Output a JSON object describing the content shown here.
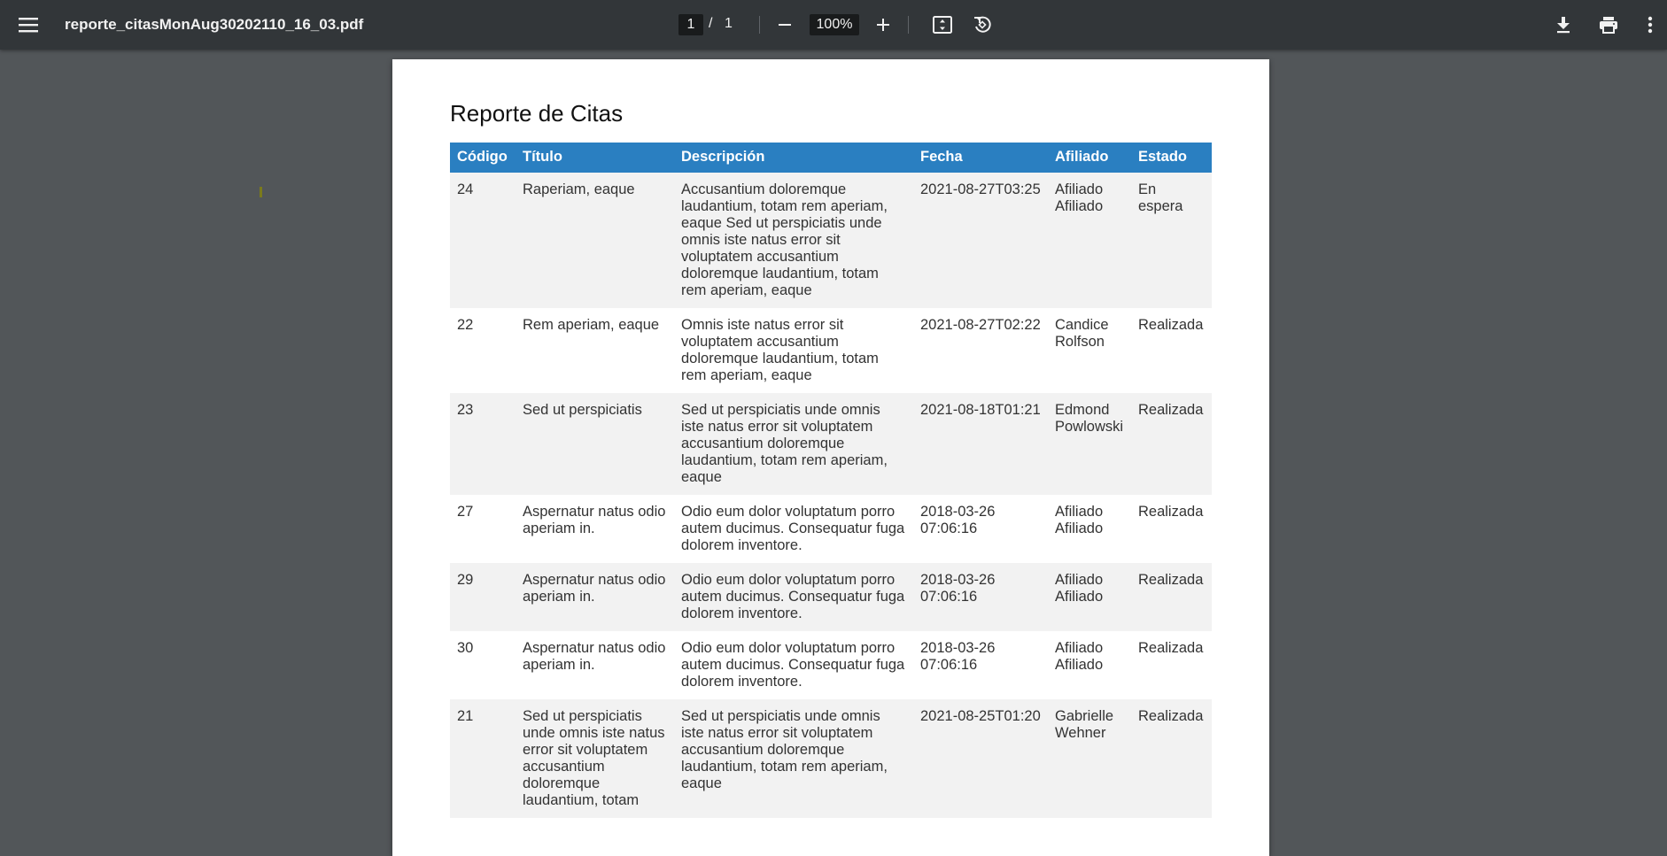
{
  "toolbar": {
    "filename": "reporte_citasMonAug30202110_16_03.pdf",
    "page_current": "1",
    "page_separator": "/",
    "page_total": "1",
    "zoom": "100%",
    "icons": {
      "menu": "hamburger-menu-icon",
      "zoom_out": "minus-icon",
      "zoom_in": "plus-icon",
      "fit": "fit-to-page-icon",
      "rotate": "rotate-icon",
      "download": "download-icon",
      "print": "print-icon",
      "more": "more-vert-icon"
    }
  },
  "colors": {
    "toolbar_bg": "#323639",
    "viewer_bg": "#525659",
    "table_header_bg": "#2a7fc1"
  },
  "document": {
    "title": "Reporte de Citas",
    "columns": [
      "Código",
      "Título",
      "Descripción",
      "Fecha",
      "Afiliado",
      "Estado"
    ],
    "rows": [
      {
        "codigo": "24",
        "titulo": "Raperiam, eaque",
        "descripcion": "Accusantium doloremque laudantium, totam rem aperiam, eaque Sed ut perspiciatis unde omnis iste natus error sit voluptatem accusantium doloremque laudantium, totam rem aperiam, eaque",
        "fecha": "2021-08-27T03:25",
        "afiliado": "Afiliado Afiliado",
        "estado": "En espera"
      },
      {
        "codigo": "22",
        "titulo": "Rem aperiam, eaque",
        "descripcion": "Omnis iste natus error sit voluptatem accusantium doloremque laudantium, totam rem aperiam, eaque",
        "fecha": "2021-08-27T02:22",
        "afiliado": "Candice Rolfson",
        "estado": "Realizada"
      },
      {
        "codigo": "23",
        "titulo": "Sed ut perspiciatis",
        "descripcion": "Sed ut perspiciatis unde omnis iste natus error sit voluptatem accusantium doloremque laudantium, totam rem aperiam, eaque",
        "fecha": "2021-08-18T01:21",
        "afiliado": "Edmond Powlowski",
        "estado": "Realizada"
      },
      {
        "codigo": "27",
        "titulo": "Aspernatur natus odio aperiam in.",
        "descripcion": "Odio eum dolor voluptatum porro autem ducimus. Consequatur fuga dolorem inventore.",
        "fecha": "2018-03-26 07:06:16",
        "afiliado": "Afiliado Afiliado",
        "estado": "Realizada"
      },
      {
        "codigo": "29",
        "titulo": "Aspernatur natus odio aperiam in.",
        "descripcion": "Odio eum dolor voluptatum porro autem ducimus. Consequatur fuga dolorem inventore.",
        "fecha": "2018-03-26 07:06:16",
        "afiliado": "Afiliado Afiliado",
        "estado": "Realizada"
      },
      {
        "codigo": "30",
        "titulo": "Aspernatur natus odio aperiam in.",
        "descripcion": "Odio eum dolor voluptatum porro autem ducimus. Consequatur fuga dolorem inventore.",
        "fecha": "2018-03-26 07:06:16",
        "afiliado": "Afiliado Afiliado",
        "estado": "Realizada"
      },
      {
        "codigo": "21",
        "titulo": "Sed ut perspiciatis unde omnis iste natus error sit voluptatem accusantium doloremque laudantium, totam",
        "descripcion": "Sed ut perspiciatis unde omnis iste natus error sit voluptatem accusantium doloremque laudantium, totam rem aperiam, eaque",
        "fecha": "2021-08-25T01:20",
        "afiliado": "Gabrielle Wehner",
        "estado": "Realizada"
      }
    ]
  }
}
